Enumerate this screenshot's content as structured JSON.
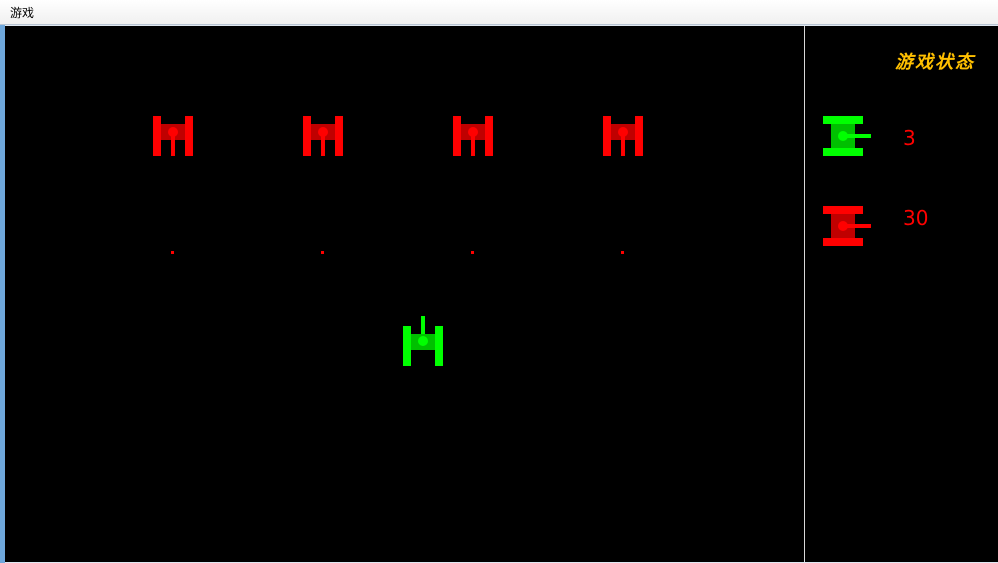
{
  "window": {
    "title": "游戏"
  },
  "status_panel": {
    "title": "游戏状态",
    "title_color": "#ffc000",
    "player_tanks_remaining": "3",
    "enemy_tanks_remaining": "30",
    "value_color": "#ff0000"
  },
  "colors": {
    "player": "#00ff00",
    "player_dark": "#00c000",
    "enemy": "#ff0000",
    "enemy_dark": "#c00000",
    "background": "#000000"
  },
  "sprites": {
    "enemy_tank": "tank-icon",
    "player_tank": "tank-icon",
    "bullet": "bullet-icon"
  }
}
